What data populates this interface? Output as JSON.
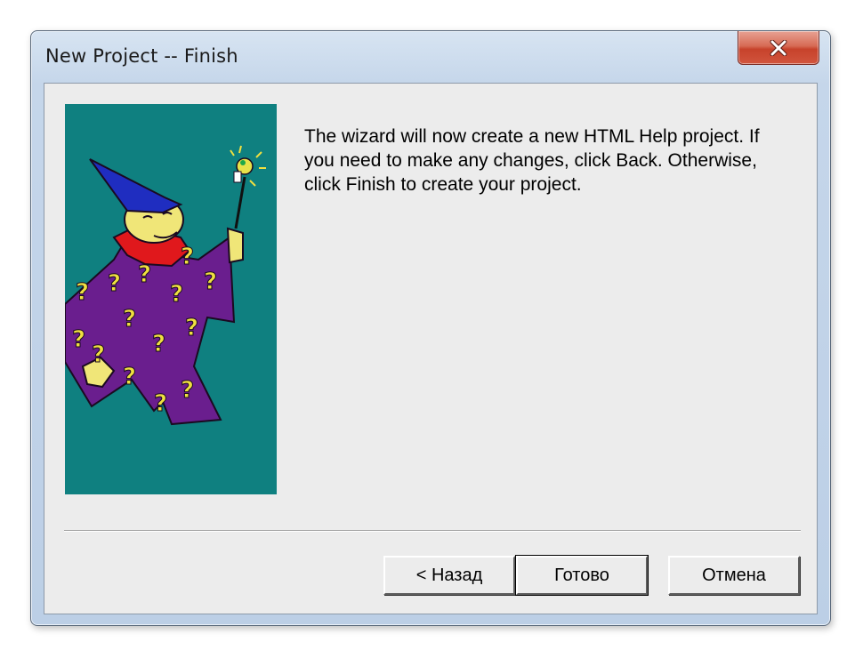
{
  "window": {
    "title": "New Project -- Finish",
    "close_icon": "close-x-icon"
  },
  "illustration": {
    "icon": "wizard-illustration",
    "background_color": "#0f8080",
    "robe_color": "#6b1f8f",
    "hat_color": "#1f2fbf",
    "beard_color": "#e11c1c"
  },
  "body": {
    "message": "The wizard will now create a new HTML Help project. If you need to make any changes, click Back. Otherwise, click Finish to create your project."
  },
  "buttons": {
    "back_label": "< Назад",
    "finish_label": "Готово",
    "cancel_label": "Отмена"
  }
}
